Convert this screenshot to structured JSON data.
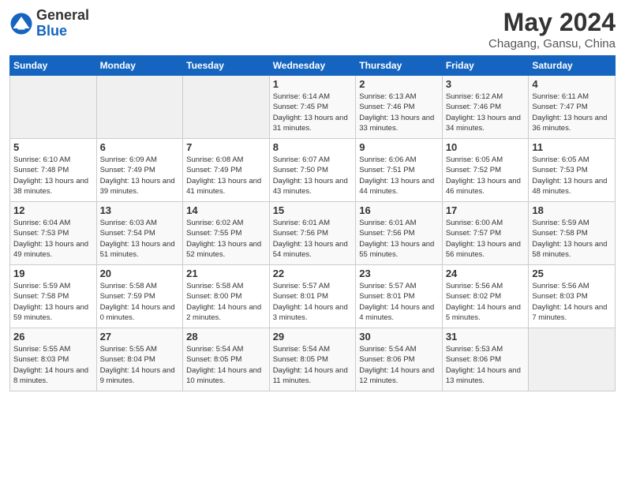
{
  "header": {
    "logo_general": "General",
    "logo_blue": "Blue",
    "month_title": "May 2024",
    "location": "Chagang, Gansu, China"
  },
  "calendar": {
    "days_of_week": [
      "Sunday",
      "Monday",
      "Tuesday",
      "Wednesday",
      "Thursday",
      "Friday",
      "Saturday"
    ],
    "weeks": [
      [
        {
          "day": "",
          "info": ""
        },
        {
          "day": "",
          "info": ""
        },
        {
          "day": "",
          "info": ""
        },
        {
          "day": "1",
          "info": "Sunrise: 6:14 AM\nSunset: 7:45 PM\nDaylight: 13 hours\nand 31 minutes."
        },
        {
          "day": "2",
          "info": "Sunrise: 6:13 AM\nSunset: 7:46 PM\nDaylight: 13 hours\nand 33 minutes."
        },
        {
          "day": "3",
          "info": "Sunrise: 6:12 AM\nSunset: 7:46 PM\nDaylight: 13 hours\nand 34 minutes."
        },
        {
          "day": "4",
          "info": "Sunrise: 6:11 AM\nSunset: 7:47 PM\nDaylight: 13 hours\nand 36 minutes."
        }
      ],
      [
        {
          "day": "5",
          "info": "Sunrise: 6:10 AM\nSunset: 7:48 PM\nDaylight: 13 hours\nand 38 minutes."
        },
        {
          "day": "6",
          "info": "Sunrise: 6:09 AM\nSunset: 7:49 PM\nDaylight: 13 hours\nand 39 minutes."
        },
        {
          "day": "7",
          "info": "Sunrise: 6:08 AM\nSunset: 7:49 PM\nDaylight: 13 hours\nand 41 minutes."
        },
        {
          "day": "8",
          "info": "Sunrise: 6:07 AM\nSunset: 7:50 PM\nDaylight: 13 hours\nand 43 minutes."
        },
        {
          "day": "9",
          "info": "Sunrise: 6:06 AM\nSunset: 7:51 PM\nDaylight: 13 hours\nand 44 minutes."
        },
        {
          "day": "10",
          "info": "Sunrise: 6:05 AM\nSunset: 7:52 PM\nDaylight: 13 hours\nand 46 minutes."
        },
        {
          "day": "11",
          "info": "Sunrise: 6:05 AM\nSunset: 7:53 PM\nDaylight: 13 hours\nand 48 minutes."
        }
      ],
      [
        {
          "day": "12",
          "info": "Sunrise: 6:04 AM\nSunset: 7:53 PM\nDaylight: 13 hours\nand 49 minutes."
        },
        {
          "day": "13",
          "info": "Sunrise: 6:03 AM\nSunset: 7:54 PM\nDaylight: 13 hours\nand 51 minutes."
        },
        {
          "day": "14",
          "info": "Sunrise: 6:02 AM\nSunset: 7:55 PM\nDaylight: 13 hours\nand 52 minutes."
        },
        {
          "day": "15",
          "info": "Sunrise: 6:01 AM\nSunset: 7:56 PM\nDaylight: 13 hours\nand 54 minutes."
        },
        {
          "day": "16",
          "info": "Sunrise: 6:01 AM\nSunset: 7:56 PM\nDaylight: 13 hours\nand 55 minutes."
        },
        {
          "day": "17",
          "info": "Sunrise: 6:00 AM\nSunset: 7:57 PM\nDaylight: 13 hours\nand 56 minutes."
        },
        {
          "day": "18",
          "info": "Sunrise: 5:59 AM\nSunset: 7:58 PM\nDaylight: 13 hours\nand 58 minutes."
        }
      ],
      [
        {
          "day": "19",
          "info": "Sunrise: 5:59 AM\nSunset: 7:58 PM\nDaylight: 13 hours\nand 59 minutes."
        },
        {
          "day": "20",
          "info": "Sunrise: 5:58 AM\nSunset: 7:59 PM\nDaylight: 14 hours\nand 0 minutes."
        },
        {
          "day": "21",
          "info": "Sunrise: 5:58 AM\nSunset: 8:00 PM\nDaylight: 14 hours\nand 2 minutes."
        },
        {
          "day": "22",
          "info": "Sunrise: 5:57 AM\nSunset: 8:01 PM\nDaylight: 14 hours\nand 3 minutes."
        },
        {
          "day": "23",
          "info": "Sunrise: 5:57 AM\nSunset: 8:01 PM\nDaylight: 14 hours\nand 4 minutes."
        },
        {
          "day": "24",
          "info": "Sunrise: 5:56 AM\nSunset: 8:02 PM\nDaylight: 14 hours\nand 5 minutes."
        },
        {
          "day": "25",
          "info": "Sunrise: 5:56 AM\nSunset: 8:03 PM\nDaylight: 14 hours\nand 7 minutes."
        }
      ],
      [
        {
          "day": "26",
          "info": "Sunrise: 5:55 AM\nSunset: 8:03 PM\nDaylight: 14 hours\nand 8 minutes."
        },
        {
          "day": "27",
          "info": "Sunrise: 5:55 AM\nSunset: 8:04 PM\nDaylight: 14 hours\nand 9 minutes."
        },
        {
          "day": "28",
          "info": "Sunrise: 5:54 AM\nSunset: 8:05 PM\nDaylight: 14 hours\nand 10 minutes."
        },
        {
          "day": "29",
          "info": "Sunrise: 5:54 AM\nSunset: 8:05 PM\nDaylight: 14 hours\nand 11 minutes."
        },
        {
          "day": "30",
          "info": "Sunrise: 5:54 AM\nSunset: 8:06 PM\nDaylight: 14 hours\nand 12 minutes."
        },
        {
          "day": "31",
          "info": "Sunrise: 5:53 AM\nSunset: 8:06 PM\nDaylight: 14 hours\nand 13 minutes."
        },
        {
          "day": "",
          "info": ""
        }
      ]
    ]
  }
}
